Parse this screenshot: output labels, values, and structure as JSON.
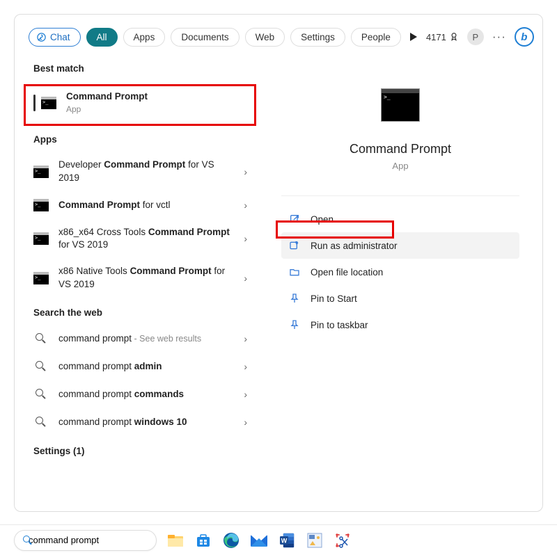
{
  "tabs": {
    "chat": "Chat",
    "all": "All",
    "list": [
      "Apps",
      "Documents",
      "Web",
      "Settings",
      "People"
    ]
  },
  "points": "4171",
  "user_initial": "P",
  "sections": {
    "best_match": "Best match",
    "apps": "Apps",
    "web": "Search the web",
    "settings": "Settings (1)"
  },
  "best_match_item": {
    "title": "Command Prompt",
    "sub": "App"
  },
  "apps_items": [
    {
      "pre": "Developer ",
      "bold": "Command Prompt",
      "post": " for VS 2019"
    },
    {
      "pre": "",
      "bold": "Command Prompt",
      "post": " for vctl"
    },
    {
      "pre": "x86_x64 Cross Tools ",
      "bold": "Command Prompt",
      "post": " for VS 2019"
    },
    {
      "pre": "x86 Native Tools ",
      "bold": "Command Prompt",
      "post": " for VS 2019"
    }
  ],
  "web_items": [
    {
      "pre": "command prompt",
      "bold": "",
      "hint": " - See web results"
    },
    {
      "pre": "command prompt ",
      "bold": "admin",
      "hint": ""
    },
    {
      "pre": "command prompt ",
      "bold": "commands",
      "hint": ""
    },
    {
      "pre": "command prompt ",
      "bold": "windows 10",
      "hint": ""
    }
  ],
  "preview": {
    "title": "Command Prompt",
    "sub": "App"
  },
  "actions": [
    {
      "label": "Open",
      "icon": "open"
    },
    {
      "label": "Run as administrator",
      "icon": "admin",
      "selected": true
    },
    {
      "label": "Open file location",
      "icon": "folder"
    },
    {
      "label": "Pin to Start",
      "icon": "pin"
    },
    {
      "label": "Pin to taskbar",
      "icon": "pin"
    }
  ],
  "taskbar": {
    "search_value": "command prompt"
  }
}
